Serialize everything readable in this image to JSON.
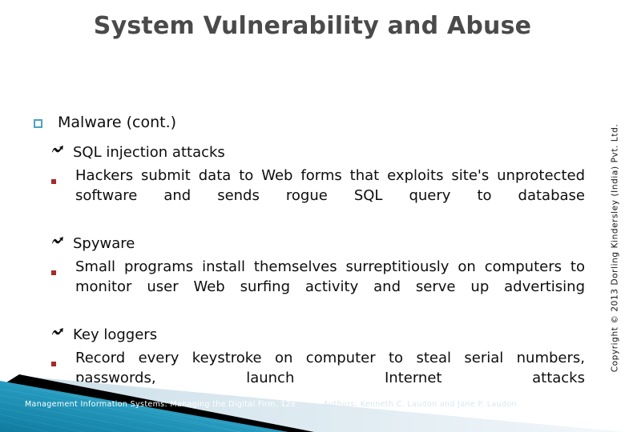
{
  "slide": {
    "title": "System Vulnerability and Abuse",
    "title_color": "#4a4a4a",
    "background": "#ffffff"
  },
  "content": {
    "level1": {
      "bullet_icon": "hollow-square-bullet",
      "bullet_color": "#49a3bd",
      "text": "Malware (cont.)"
    },
    "sections": [
      {
        "heading_bullet_icon": "curved-arrow-bullet",
        "heading": "SQL injection attacks",
        "detail_bullet_icon": "small-square-bullet",
        "detail_bullet_color": "#a62a2a",
        "detail": "Hackers submit data to Web forms that exploits site's unprotected software and sends rogue SQL query to database"
      },
      {
        "heading_bullet_icon": "curved-arrow-bullet",
        "heading": "Spyware",
        "detail_bullet_icon": "small-square-bullet",
        "detail_bullet_color": "#a62a2a",
        "detail": "Small programs install themselves surreptitiously on computers to monitor user Web surfing activity and serve up advertising"
      },
      {
        "heading_bullet_icon": "curved-arrow-bullet",
        "heading": "Key loggers",
        "detail_bullet_icon": "small-square-bullet",
        "detail_bullet_color": "#a62a2a",
        "detail": "Record every keystroke on computer to steal serial numbers, passwords, launch Internet attacks"
      }
    ]
  },
  "copyright": {
    "text": "Copyright © 2013 Dorling Kindersley (India) Pvt. Ltd."
  },
  "footer": {
    "book_title": "Management Information Systems: Managing the Digital Firm, 12e",
    "authors": "Authors: Kenneth C. Laudon and Jane P. Laudon",
    "teal_light": "#64c8de",
    "teal_dark": "#1683ab",
    "band_color": "#000000",
    "wedge_color": "#dce8ef"
  }
}
